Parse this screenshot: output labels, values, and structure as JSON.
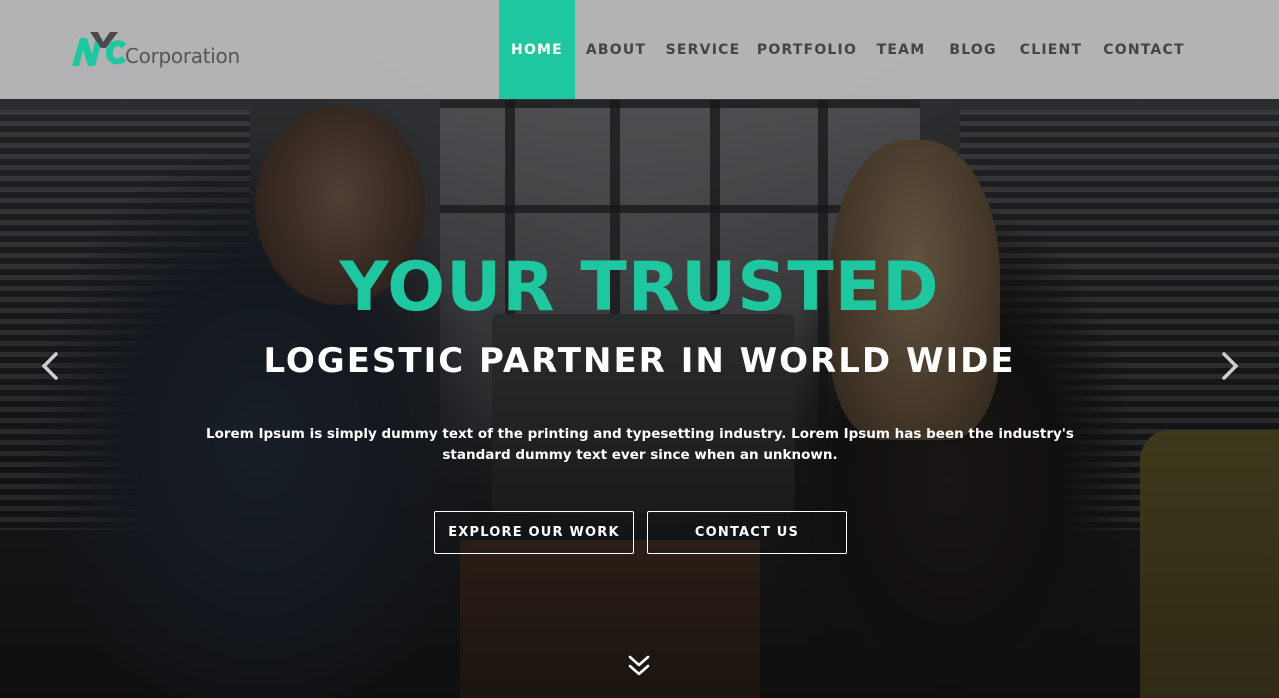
{
  "brand": {
    "logo_text": "Corporation",
    "logo_mark": "NYC",
    "accent_color": "#1fc7a0"
  },
  "nav": {
    "items": [
      {
        "label": "HOME",
        "active": true
      },
      {
        "label": "ABOUT",
        "active": false
      },
      {
        "label": "SERVICE",
        "active": false
      },
      {
        "label": "PORTFOLIO",
        "active": false
      },
      {
        "label": "TEAM",
        "active": false
      },
      {
        "label": "BLOG",
        "active": false
      },
      {
        "label": "CLIENT",
        "active": false
      },
      {
        "label": "CONTACT",
        "active": false
      }
    ]
  },
  "hero": {
    "title": "YOUR TRUSTED",
    "subtitle": "LOGESTIC PARTNER IN WORLD WIDE",
    "description": "Lorem Ipsum is simply dummy text of the printing and typesetting industry. Lorem Ipsum has been the industry's standard dummy text ever since when an unknown.",
    "buttons": {
      "explore": "EXPLORE OUR WORK",
      "contact": "CONTACT US"
    }
  },
  "icons": {
    "prev": "chevron-left-icon",
    "next": "chevron-right-icon",
    "scroll": "double-chevron-down-icon"
  }
}
